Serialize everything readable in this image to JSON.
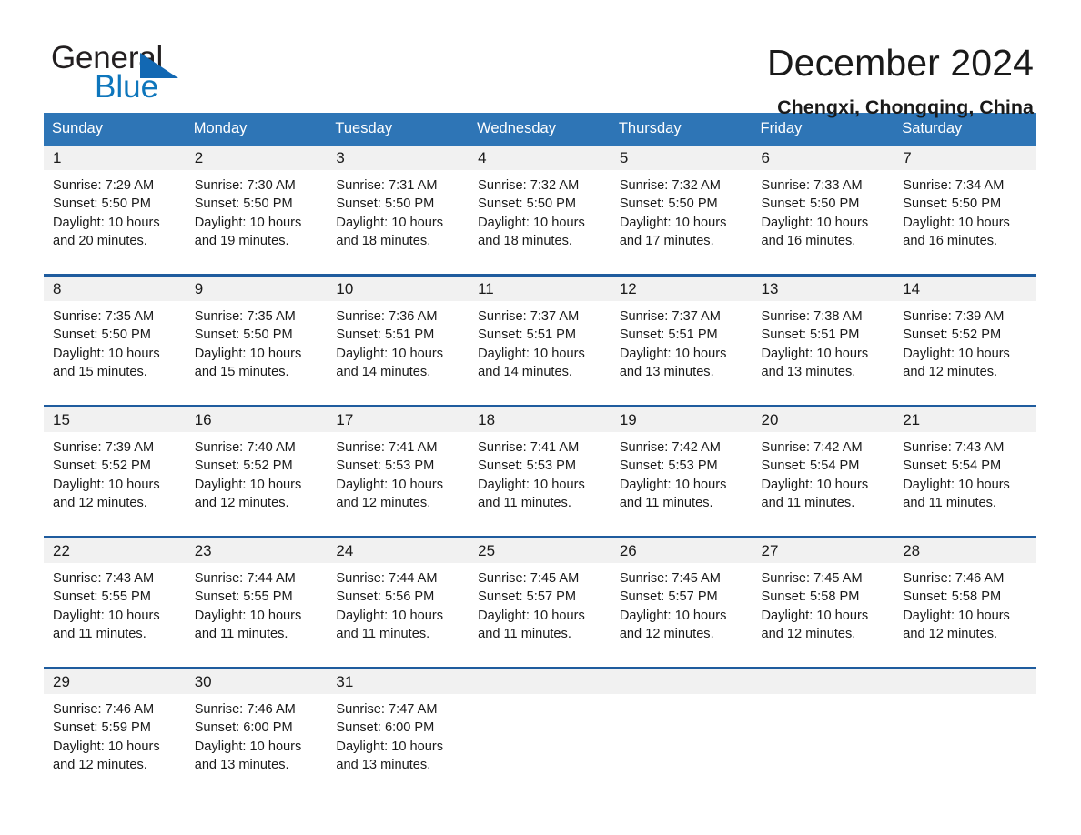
{
  "logo": {
    "word_one": "General",
    "word_two": "Blue",
    "triangle_color": "#1268b3",
    "blue_color": "#0e76bc"
  },
  "header": {
    "title": "December 2024",
    "location": "Chengxi, Chongqing, China"
  },
  "theme": {
    "header_blue": "#2e75b6",
    "separator_blue": "#1f5c9e",
    "daynum_band": "#f1f1f1",
    "text": "#1a1a1a"
  },
  "weekday_headers": [
    "Sunday",
    "Monday",
    "Tuesday",
    "Wednesday",
    "Thursday",
    "Friday",
    "Saturday"
  ],
  "weeks": [
    {
      "days": [
        {
          "num": "1",
          "detail": "Sunrise: 7:29 AM\nSunset: 5:50 PM\nDaylight: 10 hours\nand 20 minutes."
        },
        {
          "num": "2",
          "detail": "Sunrise: 7:30 AM\nSunset: 5:50 PM\nDaylight: 10 hours\nand 19 minutes."
        },
        {
          "num": "3",
          "detail": "Sunrise: 7:31 AM\nSunset: 5:50 PM\nDaylight: 10 hours\nand 18 minutes."
        },
        {
          "num": "4",
          "detail": "Sunrise: 7:32 AM\nSunset: 5:50 PM\nDaylight: 10 hours\nand 18 minutes."
        },
        {
          "num": "5",
          "detail": "Sunrise: 7:32 AM\nSunset: 5:50 PM\nDaylight: 10 hours\nand 17 minutes."
        },
        {
          "num": "6",
          "detail": "Sunrise: 7:33 AM\nSunset: 5:50 PM\nDaylight: 10 hours\nand 16 minutes."
        },
        {
          "num": "7",
          "detail": "Sunrise: 7:34 AM\nSunset: 5:50 PM\nDaylight: 10 hours\nand 16 minutes."
        }
      ]
    },
    {
      "days": [
        {
          "num": "8",
          "detail": "Sunrise: 7:35 AM\nSunset: 5:50 PM\nDaylight: 10 hours\nand 15 minutes."
        },
        {
          "num": "9",
          "detail": "Sunrise: 7:35 AM\nSunset: 5:50 PM\nDaylight: 10 hours\nand 15 minutes."
        },
        {
          "num": "10",
          "detail": "Sunrise: 7:36 AM\nSunset: 5:51 PM\nDaylight: 10 hours\nand 14 minutes."
        },
        {
          "num": "11",
          "detail": "Sunrise: 7:37 AM\nSunset: 5:51 PM\nDaylight: 10 hours\nand 14 minutes."
        },
        {
          "num": "12",
          "detail": "Sunrise: 7:37 AM\nSunset: 5:51 PM\nDaylight: 10 hours\nand 13 minutes."
        },
        {
          "num": "13",
          "detail": "Sunrise: 7:38 AM\nSunset: 5:51 PM\nDaylight: 10 hours\nand 13 minutes."
        },
        {
          "num": "14",
          "detail": "Sunrise: 7:39 AM\nSunset: 5:52 PM\nDaylight: 10 hours\nand 12 minutes."
        }
      ]
    },
    {
      "days": [
        {
          "num": "15",
          "detail": "Sunrise: 7:39 AM\nSunset: 5:52 PM\nDaylight: 10 hours\nand 12 minutes."
        },
        {
          "num": "16",
          "detail": "Sunrise: 7:40 AM\nSunset: 5:52 PM\nDaylight: 10 hours\nand 12 minutes."
        },
        {
          "num": "17",
          "detail": "Sunrise: 7:41 AM\nSunset: 5:53 PM\nDaylight: 10 hours\nand 12 minutes."
        },
        {
          "num": "18",
          "detail": "Sunrise: 7:41 AM\nSunset: 5:53 PM\nDaylight: 10 hours\nand 11 minutes."
        },
        {
          "num": "19",
          "detail": "Sunrise: 7:42 AM\nSunset: 5:53 PM\nDaylight: 10 hours\nand 11 minutes."
        },
        {
          "num": "20",
          "detail": "Sunrise: 7:42 AM\nSunset: 5:54 PM\nDaylight: 10 hours\nand 11 minutes."
        },
        {
          "num": "21",
          "detail": "Sunrise: 7:43 AM\nSunset: 5:54 PM\nDaylight: 10 hours\nand 11 minutes."
        }
      ]
    },
    {
      "days": [
        {
          "num": "22",
          "detail": "Sunrise: 7:43 AM\nSunset: 5:55 PM\nDaylight: 10 hours\nand 11 minutes."
        },
        {
          "num": "23",
          "detail": "Sunrise: 7:44 AM\nSunset: 5:55 PM\nDaylight: 10 hours\nand 11 minutes."
        },
        {
          "num": "24",
          "detail": "Sunrise: 7:44 AM\nSunset: 5:56 PM\nDaylight: 10 hours\nand 11 minutes."
        },
        {
          "num": "25",
          "detail": "Sunrise: 7:45 AM\nSunset: 5:57 PM\nDaylight: 10 hours\nand 11 minutes."
        },
        {
          "num": "26",
          "detail": "Sunrise: 7:45 AM\nSunset: 5:57 PM\nDaylight: 10 hours\nand 12 minutes."
        },
        {
          "num": "27",
          "detail": "Sunrise: 7:45 AM\nSunset: 5:58 PM\nDaylight: 10 hours\nand 12 minutes."
        },
        {
          "num": "28",
          "detail": "Sunrise: 7:46 AM\nSunset: 5:58 PM\nDaylight: 10 hours\nand 12 minutes."
        }
      ]
    },
    {
      "days": [
        {
          "num": "29",
          "detail": "Sunrise: 7:46 AM\nSunset: 5:59 PM\nDaylight: 10 hours\nand 12 minutes."
        },
        {
          "num": "30",
          "detail": "Sunrise: 7:46 AM\nSunset: 6:00 PM\nDaylight: 10 hours\nand 13 minutes."
        },
        {
          "num": "31",
          "detail": "Sunrise: 7:47 AM\nSunset: 6:00 PM\nDaylight: 10 hours\nand 13 minutes."
        },
        {
          "num": "",
          "detail": ""
        },
        {
          "num": "",
          "detail": ""
        },
        {
          "num": "",
          "detail": ""
        },
        {
          "num": "",
          "detail": ""
        }
      ]
    }
  ]
}
